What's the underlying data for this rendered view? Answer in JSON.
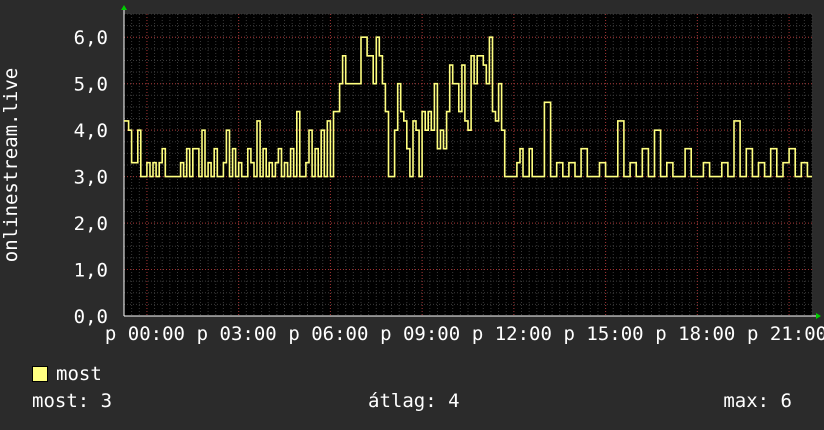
{
  "chart_data": {
    "type": "line",
    "ylabel": "onlinestream.live",
    "ylim": [
      0,
      6.5
    ],
    "yticks": [
      0,
      1,
      2,
      3,
      4,
      5,
      6
    ],
    "ytick_labels": [
      "0,0",
      "1,0",
      "2,0",
      "3,0",
      "4,0",
      "5,0",
      "6,0"
    ],
    "xlim": [
      -0.75,
      21.75
    ],
    "xticks": [
      0,
      3,
      6,
      9,
      12,
      15,
      18,
      21
    ],
    "xtick_labels": [
      "p 00:00",
      "p 03:00",
      "p 06:00",
      "p 09:00",
      "p 12:00",
      "p 15:00",
      "p 18:00",
      "p 21:00"
    ],
    "grid": true,
    "series": [
      {
        "name": "most",
        "color": "#ffff80",
        "x": [
          -0.75,
          -0.6,
          -0.5,
          -0.4,
          -0.3,
          -0.2,
          -0.1,
          0.0,
          0.1,
          0.2,
          0.3,
          0.4,
          0.5,
          0.6,
          0.7,
          0.8,
          0.9,
          1.0,
          1.1,
          1.2,
          1.3,
          1.4,
          1.5,
          1.6,
          1.7,
          1.8,
          1.9,
          2.0,
          2.1,
          2.2,
          2.3,
          2.4,
          2.5,
          2.6,
          2.7,
          2.8,
          2.9,
          3.0,
          3.1,
          3.2,
          3.3,
          3.4,
          3.5,
          3.6,
          3.7,
          3.8,
          3.9,
          4.0,
          4.1,
          4.2,
          4.3,
          4.4,
          4.5,
          4.6,
          4.7,
          4.8,
          4.9,
          5.0,
          5.1,
          5.2,
          5.3,
          5.4,
          5.5,
          5.6,
          5.7,
          5.8,
          5.9,
          6.0,
          6.1,
          6.2,
          6.3,
          6.4,
          6.5,
          6.6,
          6.7,
          6.8,
          6.9,
          7.0,
          7.2,
          7.4,
          7.5,
          7.6,
          7.7,
          7.8,
          7.9,
          8.0,
          8.1,
          8.2,
          8.3,
          8.4,
          8.5,
          8.6,
          8.7,
          8.8,
          8.9,
          9.0,
          9.1,
          9.2,
          9.3,
          9.4,
          9.5,
          9.6,
          9.7,
          9.8,
          9.9,
          10.0,
          10.1,
          10.2,
          10.3,
          10.4,
          10.5,
          10.6,
          10.7,
          10.8,
          10.9,
          11.0,
          11.1,
          11.2,
          11.3,
          11.4,
          11.5,
          11.6,
          11.7,
          11.8,
          11.9,
          12.0,
          12.1,
          12.2,
          12.3,
          12.4,
          12.5,
          12.6,
          12.8,
          13.0,
          13.2,
          13.4,
          13.6,
          13.8,
          14.0,
          14.2,
          14.4,
          14.6,
          14.8,
          15.0,
          15.2,
          15.4,
          15.6,
          15.8,
          16.0,
          16.2,
          16.4,
          16.6,
          16.8,
          17.0,
          17.2,
          17.4,
          17.6,
          17.8,
          18.0,
          18.2,
          18.4,
          18.6,
          18.8,
          19.0,
          19.2,
          19.4,
          19.6,
          19.8,
          20.0,
          20.2,
          20.4,
          20.6,
          20.8,
          21.0,
          21.2,
          21.4,
          21.6,
          21.75
        ],
        "values": [
          4.2,
          4.0,
          3.3,
          3.3,
          4.0,
          3.0,
          3.0,
          3.3,
          3.0,
          3.3,
          3.0,
          3.3,
          3.6,
          3.0,
          3.0,
          3.0,
          3.0,
          3.0,
          3.3,
          3.0,
          3.6,
          3.0,
          3.6,
          3.6,
          3.0,
          4.0,
          3.0,
          3.3,
          3.0,
          3.6,
          3.0,
          3.0,
          3.3,
          4.0,
          3.0,
          3.6,
          3.0,
          3.3,
          3.0,
          3.0,
          3.6,
          3.3,
          3.0,
          4.2,
          3.0,
          3.6,
          3.0,
          3.3,
          3.0,
          3.3,
          3.6,
          3.0,
          3.3,
          3.0,
          3.6,
          3.0,
          4.4,
          3.0,
          3.0,
          3.3,
          4.0,
          3.0,
          3.6,
          3.0,
          4.0,
          3.0,
          4.2,
          3.0,
          4.4,
          4.4,
          5.0,
          5.6,
          5.0,
          5.0,
          5.0,
          5.0,
          5.0,
          6.0,
          5.6,
          5.0,
          6.0,
          5.6,
          5.0,
          4.4,
          3.0,
          3.0,
          4.0,
          5.0,
          4.4,
          4.2,
          3.6,
          3.0,
          4.2,
          4.0,
          3.0,
          4.4,
          4.0,
          4.4,
          4.0,
          5.0,
          3.6,
          4.0,
          3.6,
          4.4,
          5.4,
          5.0,
          5.0,
          4.4,
          5.4,
          4.2,
          4.0,
          5.6,
          5.0,
          5.6,
          5.6,
          5.4,
          5.0,
          6.0,
          4.4,
          4.2,
          5.0,
          4.0,
          3.0,
          3.0,
          3.0,
          3.0,
          3.3,
          3.6,
          3.0,
          3.0,
          3.6,
          3.0,
          3.0,
          4.6,
          3.0,
          3.3,
          3.0,
          3.3,
          3.0,
          3.6,
          3.0,
          3.0,
          3.3,
          3.0,
          3.0,
          4.2,
          3.0,
          3.3,
          3.0,
          3.6,
          3.0,
          4.0,
          3.0,
          3.3,
          3.0,
          3.0,
          3.6,
          3.0,
          3.0,
          3.3,
          3.0,
          3.0,
          3.3,
          3.0,
          4.2,
          3.0,
          3.6,
          3.0,
          3.3,
          3.0,
          3.6,
          3.0,
          3.3,
          3.6,
          3.0,
          3.3,
          3.0,
          3.0
        ]
      }
    ]
  },
  "legend": {
    "label": "most",
    "color": "#ffff80"
  },
  "stats": {
    "now_label": "most:",
    "now_value": "3",
    "avg_label": "átlag:",
    "avg_value": "4",
    "max_label": "max:",
    "max_value": "6"
  }
}
